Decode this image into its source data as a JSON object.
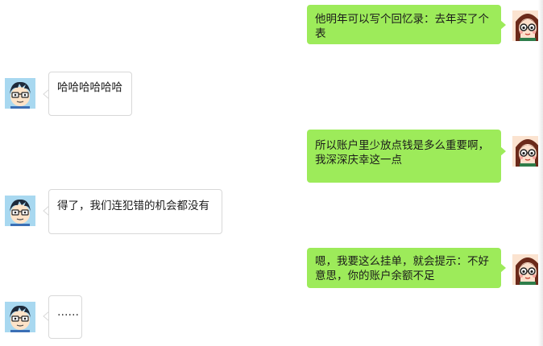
{
  "messages": [
    {
      "side": "right",
      "sender": "girl",
      "text": "他明年可以写个回忆录：去年买了个表"
    },
    {
      "side": "left",
      "sender": "boy",
      "text": "哈哈哈哈哈哈"
    },
    {
      "side": "right",
      "sender": "girl",
      "text": "所以账户里少放点钱是多么重要啊，我深深庆幸这一点"
    },
    {
      "side": "left",
      "sender": "boy",
      "text": "得了，我们连犯错的机会都没有"
    },
    {
      "side": "right",
      "sender": "girl",
      "text": "嗯，我要这么挂单，就会提示：不好意思，你的账户余额不足"
    },
    {
      "side": "left",
      "sender": "boy",
      "text": "……"
    }
  ],
  "colors": {
    "outgoing_bubble": "#9deb5a",
    "incoming_bubble": "#ffffff",
    "incoming_border": "#d8d8d8",
    "background": "#ffffff"
  },
  "icons": {
    "girl": "girl-avatar-icon",
    "boy": "boy-avatar-icon"
  }
}
